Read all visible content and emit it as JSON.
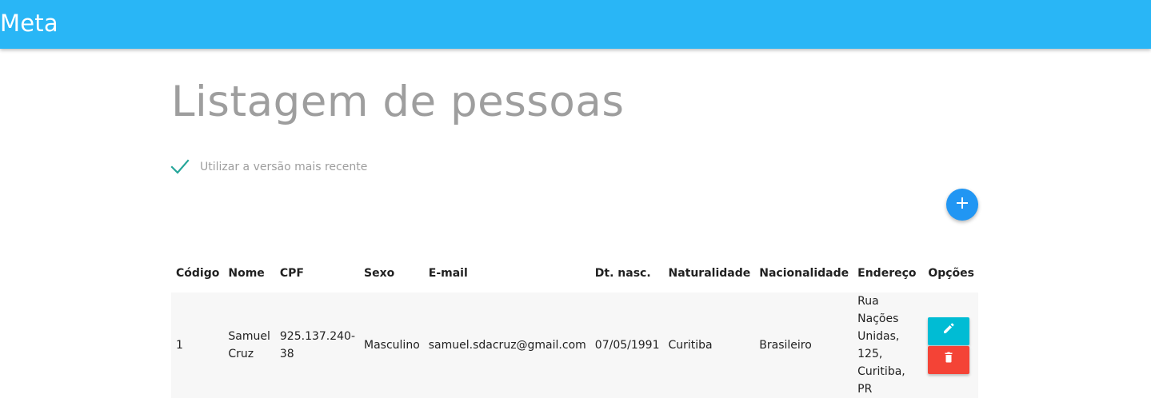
{
  "app": {
    "brand": "Meta"
  },
  "page": {
    "title": "Listagem de pessoas",
    "checkbox_label": "Utilizar a versão mais recente",
    "checkbox_checked": true
  },
  "colors": {
    "topbar": "#29b6f6",
    "fab": "#2196f3",
    "edit_button": "#00bcd4",
    "delete_button": "#f44336",
    "check": "#26a69a"
  },
  "icons": {
    "fab": "plus-icon",
    "edit": "pencil-icon",
    "delete": "trash-icon",
    "checkbox": "check-icon"
  },
  "table": {
    "headers": {
      "codigo": "Código",
      "nome": "Nome",
      "cpf": "CPF",
      "sexo": "Sexo",
      "email": "E-mail",
      "dt_nasc": "Dt. nasc.",
      "naturalidade": "Naturalidade",
      "nacionalidade": "Nacionalidade",
      "endereco": "Endereço",
      "opcoes": "Opções"
    },
    "rows": [
      {
        "codigo": "1",
        "nome": "Samuel Cruz",
        "cpf": "925.137.240-38",
        "sexo": "Masculino",
        "email": "samuel.sdacruz@gmail.com",
        "dt_nasc": "07/05/1991",
        "naturalidade": "Curitiba",
        "nacionalidade": "Brasileiro",
        "endereco": "Rua Nações Unidas, 125, Curitiba, PR"
      }
    ]
  }
}
